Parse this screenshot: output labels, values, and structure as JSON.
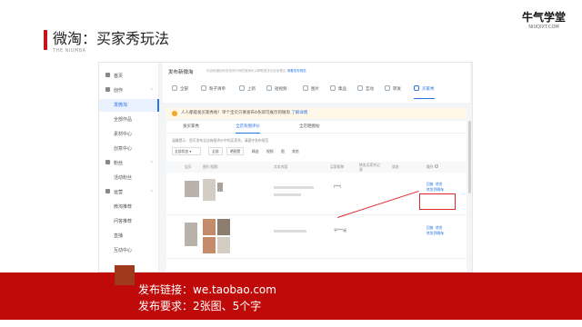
{
  "slide": {
    "title": "微淘：买家秀玩法",
    "subtitle": "THE NIUMBA",
    "brand_name": "牛气学堂",
    "brand_url": "NIUQIXT.COM"
  },
  "screenshot": {
    "panel_title": "发布新微淘",
    "panel_desc": "内容和通知有效发布时间的微淘可以帮助更多的买家看见",
    "panel_link": "请看发布规范",
    "tabs": [
      {
        "label": "全部"
      },
      {
        "label": "粉子清单"
      },
      {
        "label": "上新"
      },
      {
        "label": "短视频"
      },
      {
        "label": "图片"
      },
      {
        "label": "集品"
      },
      {
        "label": "互动"
      },
      {
        "label": "转发"
      },
      {
        "label": "买家秀"
      }
    ],
    "sidebar": [
      {
        "label": "首页"
      },
      {
        "label": "创作"
      },
      {
        "label": "发微淘"
      },
      {
        "label": "全部作品"
      },
      {
        "label": "素材中心"
      },
      {
        "label": "创意中心"
      },
      {
        "label": "粉丝"
      },
      {
        "label": "活动粉丝"
      },
      {
        "label": "运营"
      },
      {
        "label": "微淘推荐"
      },
      {
        "label": "问答推荐"
      },
      {
        "label": "直播"
      },
      {
        "label": "互动中心"
      }
    ],
    "notice_text": "人人都能发买家秀啦！单个宝贝只要发布4条即可展示到微淘",
    "notice_link": "了解详情",
    "subtabs": [
      {
        "label": "发买家秀"
      },
      {
        "label": "全店有图评价"
      },
      {
        "label": "全店晒图帖"
      }
    ],
    "hint": "温馨提示：您可发布全店有图评价中的买家秀，请遵守发布规范",
    "filter": {
      "select": "全部状态",
      "chips": [
        "全部",
        "晒图赞",
        "精选",
        "视频",
        "图",
        "其他"
      ]
    },
    "table": {
      "headers": [
        "宝贝",
        "图片/视频",
        "文本内容",
        "买家昵称",
        "转发买家秀记录",
        "状态",
        "操作"
      ],
      "rows": [
        {
          "buyer": "l***i",
          "ops": [
            "回复",
            "转发",
            "转发到微淘"
          ]
        },
        {
          "buyer": "平***谣",
          "ops": [
            "回复",
            "转发",
            "转发到微淘"
          ]
        }
      ]
    }
  },
  "banner": {
    "line1": "发布链接：we.taobao.com",
    "line2": "发布要求：2张图、5个字"
  },
  "colors": {
    "accent_red": "#c8161d",
    "banner_red": "#c00a0a",
    "link_blue": "#2a74e6"
  }
}
